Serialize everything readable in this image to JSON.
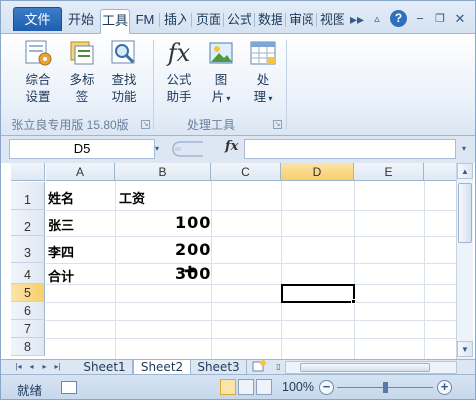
{
  "ribbon_tabs": {
    "file": "文件",
    "tabs": [
      "开始",
      "工具",
      "FM",
      "插入",
      "页面",
      "公式",
      "数据",
      "审阅",
      "视图"
    ],
    "active_index": 1
  },
  "ribbon": {
    "buttons": [
      {
        "label1": "综合",
        "label2": "设置",
        "icon": "settings-icon"
      },
      {
        "label1": "多标",
        "label2": "签",
        "icon": "multi-tab-icon"
      },
      {
        "label1": "查找",
        "label2": "功能",
        "icon": "find-icon"
      },
      {
        "label1": "公式",
        "label2": "助手",
        "icon": "fx-icon"
      },
      {
        "label1": "图",
        "label2": "片",
        "icon": "picture-icon"
      },
      {
        "label1": "处",
        "label2": "理",
        "icon": "process-icon"
      }
    ],
    "group1_label": "张立良专用版 15.80版",
    "group2_label": "处理工具",
    "fx_glyph": "fx"
  },
  "formula_bar": {
    "name_box": "D5",
    "fx_label": "fx",
    "value": ""
  },
  "sheet": {
    "columns": [
      "A",
      "B",
      "C",
      "D",
      "E"
    ],
    "selected_column": "D",
    "rows": [
      "1",
      "2",
      "3",
      "4",
      "5",
      "6",
      "7",
      "8"
    ],
    "selected_row": "5",
    "cells": {
      "A1": "姓名",
      "B1": "工资",
      "A2": "张三",
      "B2": "100",
      "A3": "李四",
      "B3": "200",
      "A4": "合计",
      "B4": "300"
    }
  },
  "sheet_tabs": [
    "Sheet1",
    "Sheet2",
    "Sheet3"
  ],
  "active_sheet": "Sheet2",
  "status": {
    "ready": "就绪",
    "zoom": "100%",
    "zoom_minus": "−",
    "zoom_plus": "+"
  }
}
